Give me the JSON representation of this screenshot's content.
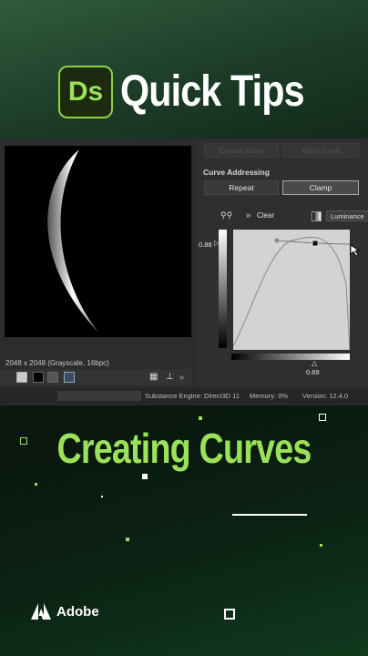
{
  "header": {
    "logo_text": "Ds",
    "title": "Quick Tips"
  },
  "app": {
    "image_info": "2048 x 2048 (Grayscale, 16bpc)",
    "top_buttons": [
      "Expose curve",
      "Apply curve"
    ],
    "section_title": "Curve Addressing",
    "addressing": {
      "repeat": "Repeat",
      "clamp": "Clamp",
      "selected": "Clamp"
    },
    "clear_label": "Clear",
    "channel": "Luminance",
    "output_value": "0.88",
    "input_value": "0.69",
    "status": {
      "engine": "Substance Engine: Direct3D 11",
      "memory": "Memory: 0%",
      "version": "Version: 12.4.0"
    }
  },
  "subtitle": "Creating Curves",
  "footer": {
    "brand": "Adobe"
  },
  "colors": {
    "accent": "#9be15a",
    "panel": "#2f2f2f"
  }
}
